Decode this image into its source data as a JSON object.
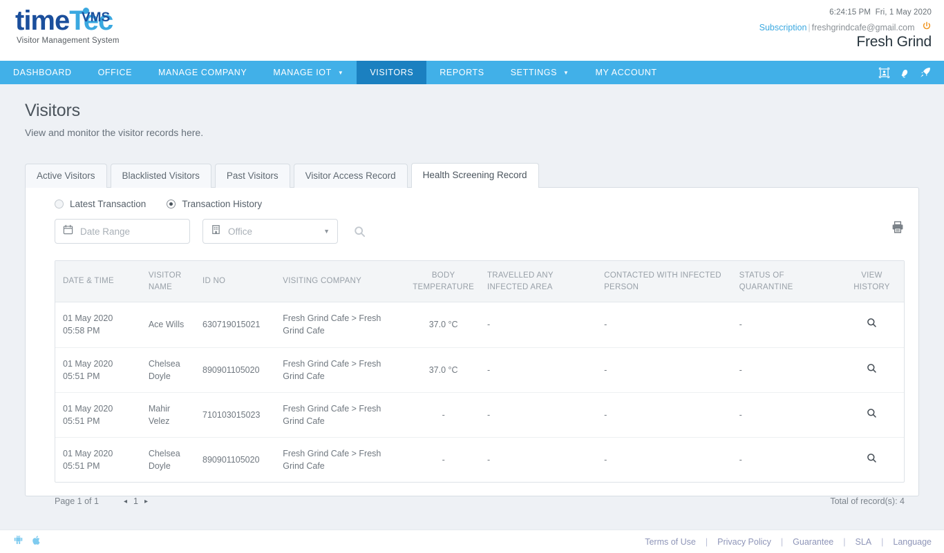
{
  "brand": {
    "logo_main_prefix": "time",
    "logo_main_suffix": "Tec",
    "logo_badge": "VMS",
    "logo_subtitle": "Visitor Management System"
  },
  "header": {
    "time": "6:24:15 PM",
    "date": "Fri, 1 May 2020",
    "subscription_label": "Subscription",
    "separator": "|",
    "email": "freshgrindcafe@gmail.com",
    "power_icon": "power-icon",
    "company": "Fresh Grind"
  },
  "nav": {
    "items": [
      {
        "label": "DASHBOARD",
        "active": false,
        "caret": false
      },
      {
        "label": "OFFICE",
        "active": false,
        "caret": false
      },
      {
        "label": "MANAGE COMPANY",
        "active": false,
        "caret": false
      },
      {
        "label": "MANAGE IOT",
        "active": false,
        "caret": true
      },
      {
        "label": "VISITORS",
        "active": true,
        "caret": false
      },
      {
        "label": "REPORTS",
        "active": false,
        "caret": false
      },
      {
        "label": "SETTINGS",
        "active": false,
        "caret": true
      },
      {
        "label": "MY ACCOUNT",
        "active": false,
        "caret": false
      }
    ],
    "icons": [
      "id-card-icon",
      "bell-icon",
      "rocket-icon"
    ]
  },
  "page": {
    "title": "Visitors",
    "subtitle": "View and monitor the visitor records here."
  },
  "tabs": [
    {
      "label": "Active Visitors",
      "active": false
    },
    {
      "label": "Blacklisted Visitors",
      "active": false
    },
    {
      "label": "Past Visitors",
      "active": false
    },
    {
      "label": "Visitor Access Record",
      "active": false
    },
    {
      "label": "Health Screening Record",
      "active": true
    }
  ],
  "filters": {
    "radios": [
      {
        "label": "Latest Transaction",
        "checked": false
      },
      {
        "label": "Transaction History",
        "checked": true
      }
    ],
    "date_range": {
      "icon": "calendar-icon",
      "placeholder": "Date Range",
      "value": ""
    },
    "office": {
      "icon": "building-icon",
      "placeholder": "Office",
      "value": ""
    },
    "search_icon": "search-icon",
    "print_icon": "printer-icon"
  },
  "table": {
    "columns": [
      "DATE & TIME",
      "VISITOR NAME",
      "ID NO",
      "VISITING COMPANY",
      "BODY TEMPERATURE",
      "TRAVELLED ANY INFECTED AREA",
      "CONTACTED WITH INFECTED PERSON",
      "STATUS OF QUARANTINE",
      "VIEW HISTORY"
    ],
    "rows": [
      {
        "date": "01 May 2020",
        "time": "05:58 PM",
        "name": "Ace Wills",
        "id_no": "630719015021",
        "company": "Fresh Grind Cafe > Fresh Grind Cafe",
        "temperature": "37.0 °C",
        "travelled": "-",
        "contacted": "-",
        "quarantine": "-",
        "view_icon": "search-icon"
      },
      {
        "date": "01 May 2020",
        "time": "05:51 PM",
        "name": "Chelsea Doyle",
        "id_no": "890901105020",
        "company": "Fresh Grind Cafe > Fresh Grind Cafe",
        "temperature": "37.0 °C",
        "travelled": "-",
        "contacted": "-",
        "quarantine": "-",
        "view_icon": "search-icon"
      },
      {
        "date": "01 May 2020",
        "time": "05:51 PM",
        "name": "Mahir Velez",
        "id_no": "710103015023",
        "company": "Fresh Grind Cafe > Fresh Grind Cafe",
        "temperature": "-",
        "travelled": "-",
        "contacted": "-",
        "quarantine": "-",
        "view_icon": "search-icon"
      },
      {
        "date": "01 May 2020",
        "time": "05:51 PM",
        "name": "Chelsea Doyle",
        "id_no": "890901105020",
        "company": "Fresh Grind Cafe > Fresh Grind Cafe",
        "temperature": "-",
        "travelled": "-",
        "contacted": "-",
        "quarantine": "-",
        "view_icon": "search-icon"
      }
    ]
  },
  "pagination": {
    "page_label": "Page 1 of 1",
    "prev_arrow": "◂",
    "current_page": "1",
    "next_arrow": "▸",
    "total_label": "Total of record(s): 4"
  },
  "footer": {
    "store_icons": [
      "android-icon",
      "apple-icon"
    ],
    "links": [
      "Terms of Use",
      "Privacy Policy",
      "Guarantee",
      "SLA",
      "Language"
    ],
    "separator": "|"
  },
  "colors": {
    "nav_blue": "#41b0e8",
    "nav_active_blue": "#1b80c0",
    "brand_dark_blue": "#1b4f9c",
    "brand_light_blue": "#3aa8e0",
    "power_orange": "#f0941f",
    "page_bg": "#eef1f5"
  }
}
